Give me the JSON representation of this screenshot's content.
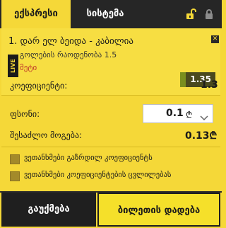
{
  "tabs": {
    "express": "ექსპრესი",
    "system": "სისტემა"
  },
  "icons": {
    "unlock": "unlock-icon",
    "lock": "lock-icon",
    "close": "close-icon",
    "chevron": "chevron-down-icon"
  },
  "bet": {
    "title": "1. დარ ელ ბეიდა - კაბილია",
    "live": "LIVE",
    "market": "გოლების რაოდენობა 1.5",
    "pick": "მეტი",
    "odds": "1.35",
    "close_label": "✕"
  },
  "coefficient": {
    "label": "კოეფიციენტი:",
    "value": "1.3"
  },
  "stake": {
    "label": "ფსონი:",
    "value": "0.1",
    "currency": "₾"
  },
  "win": {
    "label": "შესაძლო მოგება:",
    "value": "0.13₾"
  },
  "options": [
    {
      "label": "ვეთანხმები გაზრდილ კოეფიციენტს",
      "checked": false
    },
    {
      "label": "ვეთანხმები კოეფიციენტების ცვლილებას",
      "checked": false
    }
  ],
  "buttons": {
    "clear": "გაუქმება",
    "place": "ბილეთის დადება"
  },
  "colors": {
    "accent": "#f5d838",
    "dark": "#262626",
    "pick": "#c0392b",
    "odds": "#4a4a1e"
  }
}
